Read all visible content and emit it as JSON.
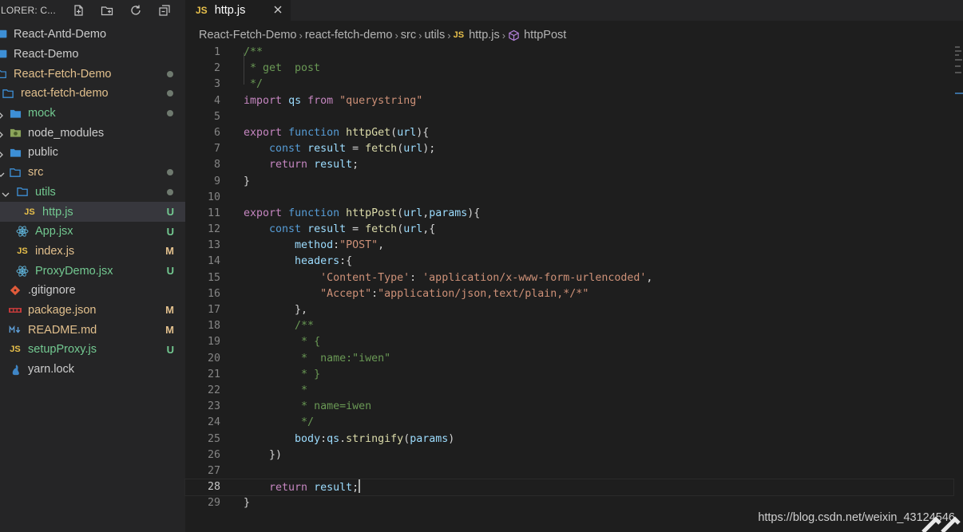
{
  "sidebar": {
    "title": "LORER: C...",
    "actions": [
      {
        "icon": "new-file-icon"
      },
      {
        "icon": "new-folder-icon"
      },
      {
        "icon": "refresh-icon"
      },
      {
        "icon": "collapse-all-icon"
      }
    ],
    "tree": [
      {
        "label": "React-Antd-Demo",
        "kind": "root-folder",
        "color": "white"
      },
      {
        "label": "React-Demo",
        "kind": "root-folder",
        "color": "white"
      },
      {
        "label": "React-Fetch-Demo",
        "kind": "root-folder",
        "color": "orange",
        "status": "dot"
      },
      {
        "label": "react-fetch-demo",
        "kind": "folder-open",
        "color": "orange",
        "status": "dot"
      },
      {
        "label": "mock",
        "kind": "folder",
        "color": "green",
        "status": "dot"
      },
      {
        "label": "node_modules",
        "kind": "folder-node",
        "color": "white"
      },
      {
        "label": "public",
        "kind": "folder",
        "color": "white"
      },
      {
        "label": "src",
        "kind": "folder-open",
        "color": "orange",
        "status": "dot"
      },
      {
        "label": "utils",
        "kind": "folder-open",
        "color": "green",
        "status": "dot"
      },
      {
        "label": "http.js",
        "kind": "js",
        "color": "green",
        "status": "U",
        "selected": true
      },
      {
        "label": "App.jsx",
        "kind": "react",
        "color": "green",
        "status": "U"
      },
      {
        "label": "index.js",
        "kind": "js",
        "color": "orange",
        "status": "M"
      },
      {
        "label": "ProxyDemo.jsx",
        "kind": "react",
        "color": "green",
        "status": "U"
      },
      {
        "label": ".gitignore",
        "kind": "git",
        "color": "white"
      },
      {
        "label": "package.json",
        "kind": "npm",
        "color": "orange",
        "status": "M"
      },
      {
        "label": "README.md",
        "kind": "md",
        "color": "orange",
        "status": "M"
      },
      {
        "label": "setupProxy.js",
        "kind": "js",
        "color": "green",
        "status": "U"
      },
      {
        "label": "yarn.lock",
        "kind": "yarn",
        "color": "white"
      }
    ]
  },
  "tab": {
    "icon_text": "JS",
    "label": "http.js"
  },
  "breadcrumb": {
    "items": [
      "React-Fetch-Demo",
      "react-fetch-demo",
      "src",
      "utils",
      "http.js",
      "httpPost"
    ],
    "file_icon_text": "JS"
  },
  "editor": {
    "current_line": 28,
    "lines": [
      {
        "n": "1",
        "tokens": [
          [
            "cm",
            "/**"
          ]
        ]
      },
      {
        "n": "2",
        "tokens": [
          [
            "cm",
            " * get  post"
          ]
        ]
      },
      {
        "n": "3",
        "tokens": [
          [
            "cm",
            " */"
          ]
        ]
      },
      {
        "n": "4",
        "tokens": [
          [
            "kw",
            "import"
          ],
          [
            "pl",
            " "
          ],
          [
            "var",
            "qs"
          ],
          [
            "pl",
            " "
          ],
          [
            "kw",
            "from"
          ],
          [
            "pl",
            " "
          ],
          [
            "str",
            "\"querystring\""
          ]
        ]
      },
      {
        "n": "5",
        "tokens": []
      },
      {
        "n": "6",
        "tokens": [
          [
            "kw",
            "export"
          ],
          [
            "pl",
            " "
          ],
          [
            "kb",
            "function"
          ],
          [
            "pl",
            " "
          ],
          [
            "fn",
            "httpGet"
          ],
          [
            "pl",
            "("
          ],
          [
            "var",
            "url"
          ],
          [
            "pl",
            "){"
          ]
        ]
      },
      {
        "n": "7",
        "tokens": [
          [
            "pl",
            "    "
          ],
          [
            "kb",
            "const"
          ],
          [
            "pl",
            " "
          ],
          [
            "var",
            "result"
          ],
          [
            "pl",
            " = "
          ],
          [
            "fn",
            "fetch"
          ],
          [
            "pl",
            "("
          ],
          [
            "var",
            "url"
          ],
          [
            "pl",
            ");"
          ]
        ]
      },
      {
        "n": "8",
        "tokens": [
          [
            "pl",
            "    "
          ],
          [
            "kw",
            "return"
          ],
          [
            "pl",
            " "
          ],
          [
            "var",
            "result"
          ],
          [
            "pl",
            ";"
          ]
        ]
      },
      {
        "n": "9",
        "tokens": [
          [
            "pl",
            "}"
          ]
        ]
      },
      {
        "n": "10",
        "tokens": []
      },
      {
        "n": "11",
        "tokens": [
          [
            "kw",
            "export"
          ],
          [
            "pl",
            " "
          ],
          [
            "kb",
            "function"
          ],
          [
            "pl",
            " "
          ],
          [
            "fn",
            "httpPost"
          ],
          [
            "pl",
            "("
          ],
          [
            "var",
            "url"
          ],
          [
            "pl",
            ","
          ],
          [
            "var",
            "params"
          ],
          [
            "pl",
            "){"
          ]
        ]
      },
      {
        "n": "12",
        "tokens": [
          [
            "pl",
            "    "
          ],
          [
            "kb",
            "const"
          ],
          [
            "pl",
            " "
          ],
          [
            "var",
            "result"
          ],
          [
            "pl",
            " = "
          ],
          [
            "fn",
            "fetch"
          ],
          [
            "pl",
            "("
          ],
          [
            "var",
            "url"
          ],
          [
            "pl",
            ",{"
          ]
        ]
      },
      {
        "n": "13",
        "tokens": [
          [
            "pl",
            "        "
          ],
          [
            "var",
            "method"
          ],
          [
            "pl",
            ":"
          ],
          [
            "str",
            "\"POST\""
          ],
          [
            "pl",
            ","
          ]
        ]
      },
      {
        "n": "14",
        "tokens": [
          [
            "pl",
            "        "
          ],
          [
            "var",
            "headers"
          ],
          [
            "pl",
            ":{"
          ]
        ]
      },
      {
        "n": "15",
        "tokens": [
          [
            "pl",
            "            "
          ],
          [
            "str",
            "'Content-Type'"
          ],
          [
            "pl",
            ": "
          ],
          [
            "str",
            "'application/x-www-form-urlencoded'"
          ],
          [
            "pl",
            ","
          ]
        ]
      },
      {
        "n": "16",
        "tokens": [
          [
            "pl",
            "            "
          ],
          [
            "str",
            "\"Accept\""
          ],
          [
            "pl",
            ":"
          ],
          [
            "str",
            "\"application/json,text/plain,*/*\""
          ]
        ]
      },
      {
        "n": "17",
        "tokens": [
          [
            "pl",
            "        },"
          ]
        ]
      },
      {
        "n": "18",
        "tokens": [
          [
            "pl",
            "        "
          ],
          [
            "cm",
            "/**"
          ]
        ]
      },
      {
        "n": "19",
        "tokens": [
          [
            "pl",
            "        "
          ],
          [
            "cm",
            " * {"
          ]
        ]
      },
      {
        "n": "20",
        "tokens": [
          [
            "pl",
            "        "
          ],
          [
            "cm",
            " *  name:\"iwen\""
          ]
        ]
      },
      {
        "n": "21",
        "tokens": [
          [
            "pl",
            "        "
          ],
          [
            "cm",
            " * }"
          ]
        ]
      },
      {
        "n": "22",
        "tokens": [
          [
            "pl",
            "        "
          ],
          [
            "cm",
            " *"
          ]
        ]
      },
      {
        "n": "23",
        "tokens": [
          [
            "pl",
            "        "
          ],
          [
            "cm",
            " * name=iwen"
          ]
        ]
      },
      {
        "n": "24",
        "tokens": [
          [
            "pl",
            "        "
          ],
          [
            "cm",
            " */"
          ]
        ]
      },
      {
        "n": "25",
        "tokens": [
          [
            "pl",
            "        "
          ],
          [
            "var",
            "body"
          ],
          [
            "pl",
            ":"
          ],
          [
            "var",
            "qs"
          ],
          [
            "pl",
            "."
          ],
          [
            "fn",
            "stringify"
          ],
          [
            "pl",
            "("
          ],
          [
            "var",
            "params"
          ],
          [
            "pl",
            ")"
          ]
        ]
      },
      {
        "n": "26",
        "tokens": [
          [
            "pl",
            "    })"
          ]
        ]
      },
      {
        "n": "27",
        "tokens": []
      },
      {
        "n": "28",
        "tokens": [
          [
            "pl",
            "    "
          ],
          [
            "kw",
            "return"
          ],
          [
            "pl",
            " "
          ],
          [
            "var",
            "result"
          ],
          [
            "pl",
            ";"
          ]
        ]
      },
      {
        "n": "29",
        "tokens": [
          [
            "pl",
            "}"
          ]
        ]
      }
    ]
  },
  "watermark": "https://blog.csdn.net/weixin_43124546",
  "colors": {
    "status_green": "#73c991",
    "status_orange": "#e2c08d",
    "folder_blue": "#3d8fd6",
    "js_yellow": "#e8c04b"
  }
}
